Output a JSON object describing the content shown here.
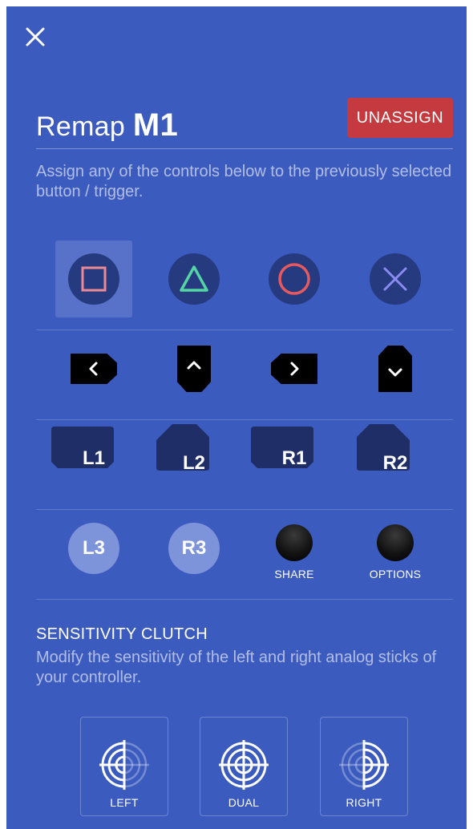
{
  "header": {
    "title_prefix": "Remap",
    "selected_button": "M1",
    "unassign_label": "UNASSIGN",
    "description": "Assign any of the controls below to the previously selected button / trigger."
  },
  "face_buttons": [
    {
      "name": "square",
      "color": "#e98a95",
      "selected": true
    },
    {
      "name": "triangle",
      "color": "#55d4a6"
    },
    {
      "name": "circle",
      "color": "#e65a5f"
    },
    {
      "name": "cross",
      "color": "#8b8bf2"
    }
  ],
  "dpad": [
    {
      "name": "dpad-left",
      "icon": "chevron-left-icon"
    },
    {
      "name": "dpad-up",
      "icon": "chevron-up-icon"
    },
    {
      "name": "dpad-right",
      "icon": "chevron-right-icon"
    },
    {
      "name": "dpad-down",
      "icon": "chevron-down-icon"
    }
  ],
  "shoulder_buttons": [
    {
      "label": "L1"
    },
    {
      "label": "L2"
    },
    {
      "label": "R1"
    },
    {
      "label": "R2"
    }
  ],
  "misc_buttons": {
    "l3": "L3",
    "r3": "R3",
    "share": "SHARE",
    "options": "OPTIONS"
  },
  "sensitivity": {
    "title": "SENSITIVITY CLUTCH",
    "description": "Modify the sensitivity of the left and right analog sticks of your controller.",
    "options": [
      {
        "label": "LEFT"
      },
      {
        "label": "DUAL"
      },
      {
        "label": "RIGHT"
      }
    ]
  },
  "colors": {
    "background": "#3c5bbf",
    "button_fill": "#263a80",
    "shoulder_fill": "#1f2e66",
    "unassign": "#c53a3f",
    "stick_fill": "#7d93da"
  }
}
